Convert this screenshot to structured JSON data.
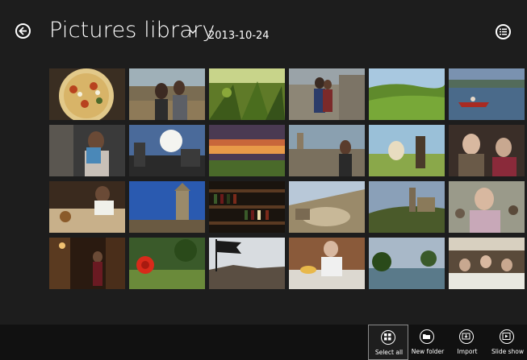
{
  "header": {
    "back_icon": "back-arrow-icon",
    "title": "Pictures library",
    "title_chevron_icon": "chevron-down-icon",
    "date": "2013-10-24",
    "view_icon": "list-view-icon"
  },
  "grid": {
    "photos": [
      {
        "subject": "pizza"
      },
      {
        "subject": "couple-outdoors"
      },
      {
        "subject": "vineyard"
      },
      {
        "subject": "couple-stone-wall"
      },
      {
        "subject": "green-hills"
      },
      {
        "subject": "rowing-boat-lake"
      },
      {
        "subject": "woman-reading"
      },
      {
        "subject": "sunlit-cathedral"
      },
      {
        "subject": "sunset-sky"
      },
      {
        "subject": "woman-hilltop-town"
      },
      {
        "subject": "dog-jumping"
      },
      {
        "subject": "older-couple"
      },
      {
        "subject": "chef-cooking"
      },
      {
        "subject": "bell-tower-blue-sky"
      },
      {
        "subject": "wine-shelves"
      },
      {
        "subject": "aerial-town"
      },
      {
        "subject": "hill-village"
      },
      {
        "subject": "man-in-crowd"
      },
      {
        "subject": "night-street"
      },
      {
        "subject": "red-flower"
      },
      {
        "subject": "flag-hill-silhouette"
      },
      {
        "subject": "man-eating-terrace"
      },
      {
        "subject": "lake-trees"
      },
      {
        "subject": "dinner-party"
      }
    ]
  },
  "appbar": {
    "commands": [
      {
        "label": "Select all",
        "icon": "select-all-icon",
        "selected": true
      },
      {
        "label": "New folder",
        "icon": "new-folder-icon",
        "selected": false
      },
      {
        "label": "Import",
        "icon": "import-icon",
        "selected": false
      },
      {
        "label": "Slide show",
        "icon": "slide-show-icon",
        "selected": false
      }
    ]
  }
}
